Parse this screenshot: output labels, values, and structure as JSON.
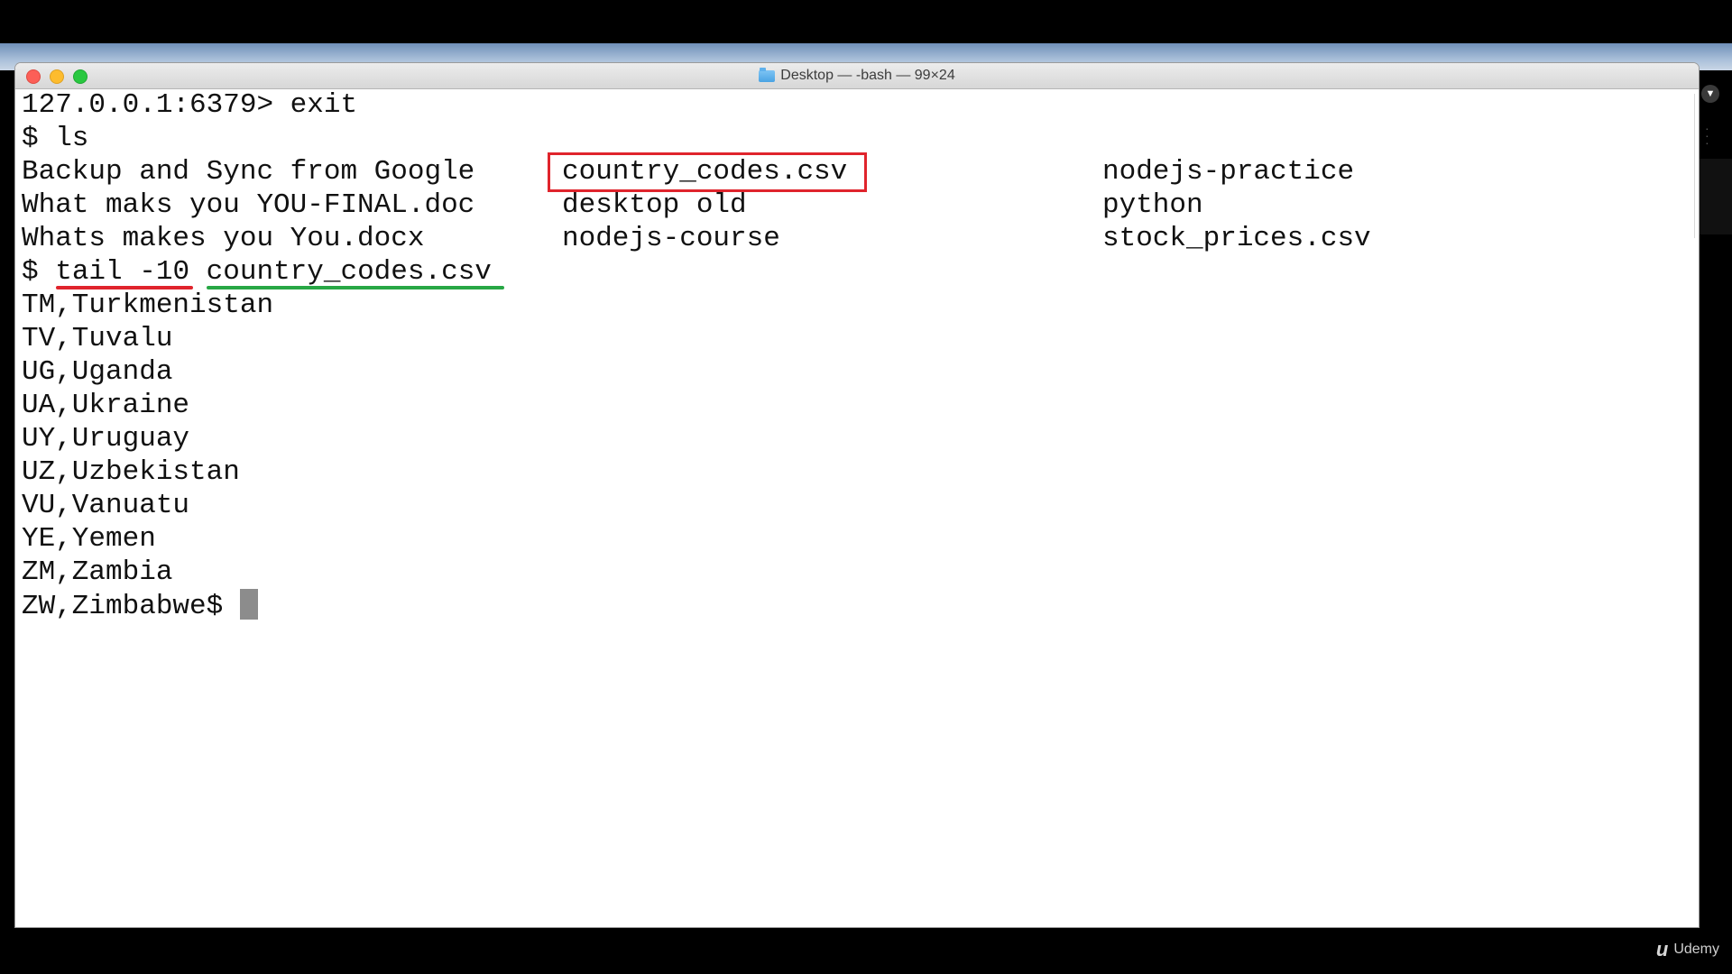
{
  "window": {
    "title": "Desktop — -bash — 99×24"
  },
  "terminal": {
    "lines": [
      "127.0.0.1:6379> exit",
      "$ ls"
    ],
    "ls_output": {
      "col1": [
        "Backup and Sync from Google",
        "What maks you YOU-FINAL.doc",
        "Whats makes you You.docx"
      ],
      "col2": [
        "country_codes.csv",
        "desktop old",
        "nodejs-course"
      ],
      "col3": [
        "nodejs-practice",
        "python",
        "stock_prices.csv"
      ]
    },
    "command": {
      "prompt": "$ ",
      "cmd": "tail -10",
      "arg": "country_codes.csv"
    },
    "output": [
      "TM,Turkmenistan",
      "TV,Tuvalu",
      "UG,Uganda",
      "UA,Ukraine",
      "UY,Uruguay",
      "UZ,Uzbekistan",
      "VU,Vanuatu",
      "YE,Yemen",
      "ZM,Zambia"
    ],
    "last_line": "ZW,Zimbabwe$ "
  },
  "annotations": {
    "box_color": "#e0242c",
    "underline_cmd_color": "#e0242c",
    "underline_arg_color": "#28a745"
  },
  "watermark": {
    "icon": "udemy-logo-icon",
    "text": "Udemy"
  }
}
